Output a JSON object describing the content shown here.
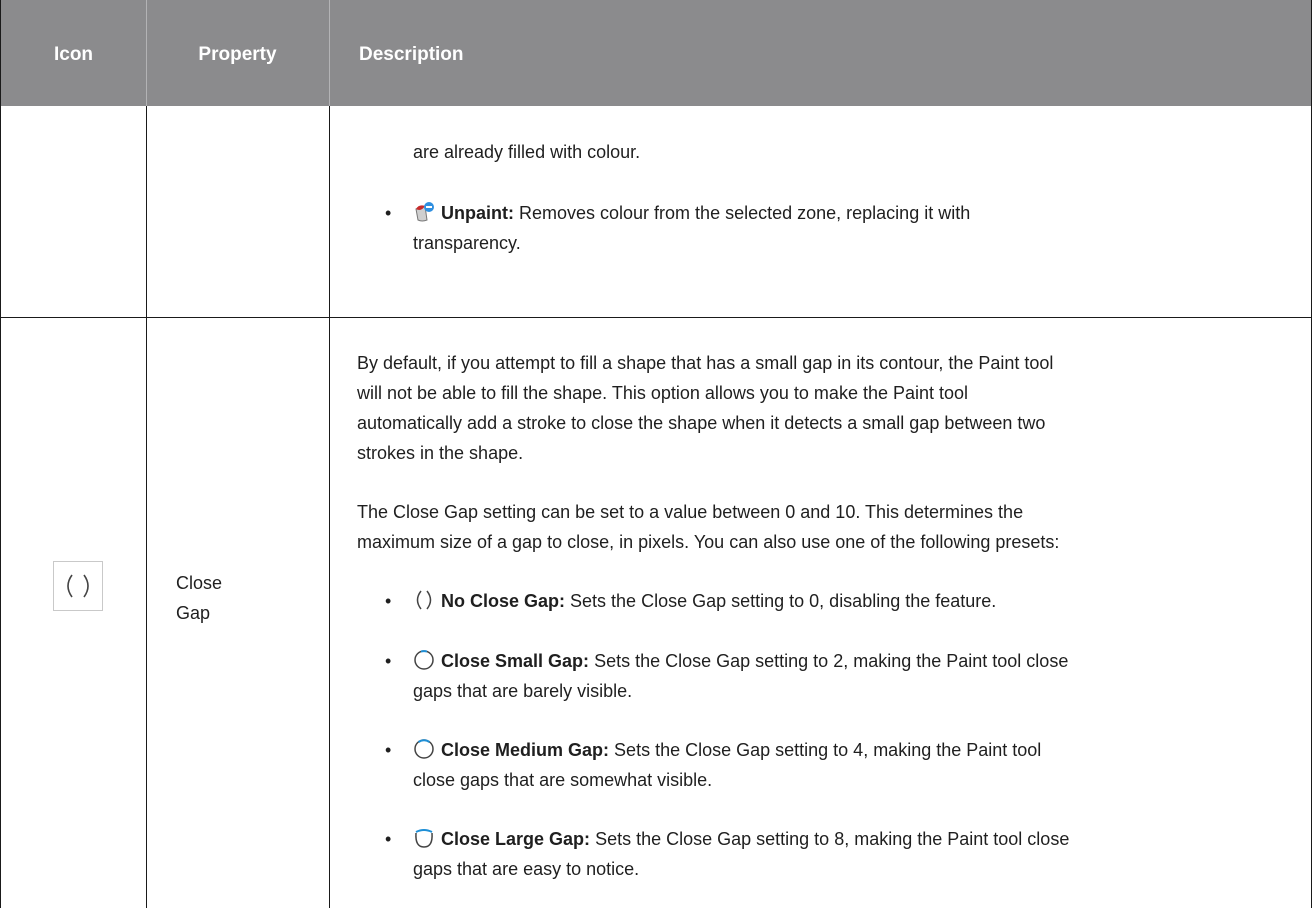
{
  "header": {
    "col_icon": "Icon",
    "col_property": "Property",
    "col_description": "Description"
  },
  "row1": {
    "continued_text": "are already filled with colour.",
    "unpaint": {
      "icon": "unpaint-bucket-icon",
      "label": "Unpaint:",
      "desc_line1": "Removes colour from the selected zone, replacing it with",
      "desc_line2": "transparency."
    }
  },
  "row2": {
    "icon": "close-gap-icon",
    "property_line1": "Close",
    "property_line2": "Gap",
    "para1": [
      "By default, if you attempt to fill a shape that has a small gap in its contour, the Paint tool",
      "will not be able to fill the shape. This option allows you to make the Paint tool",
      "automatically add a stroke to close the shape when it detects a small gap between two",
      "strokes in the shape."
    ],
    "para2": [
      "The Close Gap setting can be set to a value between 0 and 10. This determines the",
      "maximum size of a gap to close, in pixels. You can also use one of the following presets:"
    ],
    "presets": [
      {
        "icon": "no-close-gap-icon",
        "label": "No Close Gap:",
        "desc1": "Sets the Close Gap setting to 0, disabling the feature.",
        "desc2": ""
      },
      {
        "icon": "close-small-gap-icon",
        "label": "Close Small Gap:",
        "desc1": "Sets the Close Gap setting to 2, making the Paint tool close",
        "desc2": "gaps that are barely visible."
      },
      {
        "icon": "close-medium-gap-icon",
        "label": "Close Medium Gap:",
        "desc1": "Sets the Close Gap setting to 4, making the Paint tool",
        "desc2": "close gaps that are somewhat visible."
      },
      {
        "icon": "close-large-gap-icon",
        "label": "Close Large Gap:",
        "desc1": "Sets the Close Gap setting to 8, making the Paint tool close",
        "desc2": "gaps that are easy to notice."
      }
    ]
  }
}
